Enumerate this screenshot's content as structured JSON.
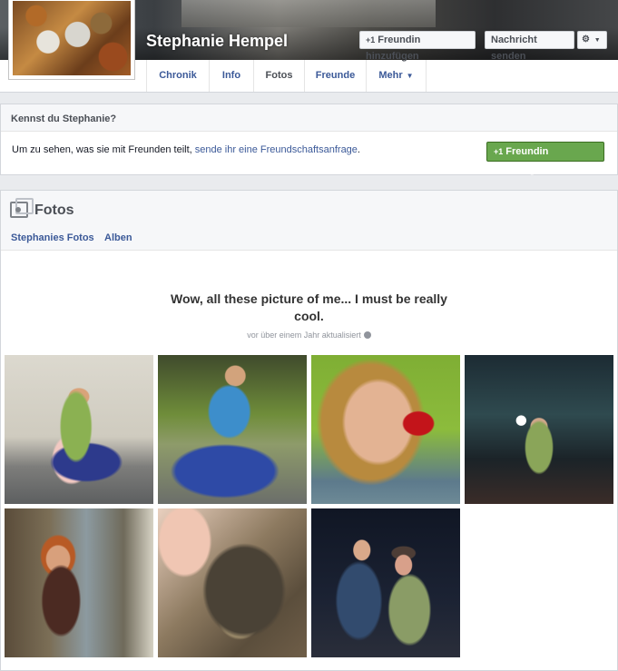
{
  "profile": {
    "name": "Stephanie Hempel"
  },
  "header_buttons": {
    "add_friend": "Freundin hinzufügen",
    "add_friend_icon": "person-plus-icon",
    "message": "Nachricht senden",
    "settings_icon": "gear-icon",
    "settings_caret": "▼"
  },
  "tabs": [
    {
      "label": "Chronik"
    },
    {
      "label": "Info"
    },
    {
      "label": "Fotos",
      "active": true
    },
    {
      "label": "Freunde"
    },
    {
      "label": "Mehr",
      "caret": "▼"
    }
  ],
  "know_box": {
    "heading": "Kennst du Stephanie?",
    "text_prefix": "Um zu sehen, was sie mit Freunden teilt, ",
    "link": "sende ihr eine Freundschaftsanfrage",
    "text_suffix": ".",
    "button": "Freundin hinzufügen"
  },
  "photos": {
    "title": "Fotos",
    "sub_tabs": [
      "Stephanies Fotos",
      "Alben"
    ],
    "album_title": "Wow, all these picture of me... I must be really cool.",
    "updated": "vor über einem Jahr aktualisiert",
    "updated_icon": "globe-icon",
    "count": 7
  },
  "colors": {
    "link": "#3b5998",
    "green_button": "#69a74e",
    "page_bg": "#e9ebee"
  }
}
